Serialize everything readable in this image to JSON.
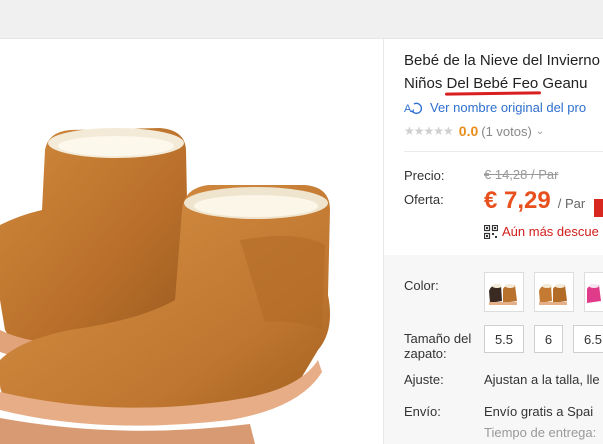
{
  "product": {
    "title_line1": "Bebé de la Nieve del Invierno",
    "title_line2_pre": "Niños ",
    "title_line2_highlight": "Del Bebé Feo",
    "title_line2_post": " Geanu",
    "translate_link": "Ver nombre original del pro",
    "rating_score": "0.0",
    "rating_votes": "(1 votos)",
    "stars_filled": 0
  },
  "pricing": {
    "price_label": "Precio:",
    "original_price": "€ 14,28 / Par",
    "offer_label": "Oferta:",
    "offer_price": "€ 7,29",
    "offer_unit": "/ Par",
    "promo_text": "Aún más descue"
  },
  "options": {
    "color_label": "Color:",
    "colors": [
      "black-brown",
      "brown",
      "pink"
    ],
    "size_label_line1": "Tamaño del",
    "size_label_line2": "zapato:",
    "sizes": [
      "5.5",
      "6",
      "6.5"
    ],
    "fit_label": "Ajuste:",
    "fit_value": "Ajustan a la talla, lle",
    "shipping_label": "Envío:",
    "shipping_value": "Envío gratis a Spai",
    "delivery_value": "Tiempo de entrega:"
  },
  "colors": {
    "accent_orange": "#e8501e",
    "link_blue": "#2e6fcf",
    "promo_red": "#d0201b",
    "boot_brown": "#c47a32"
  },
  "icons": [
    "translate-icon",
    "star-icon",
    "chevron-down-icon",
    "qr-code-icon"
  ]
}
